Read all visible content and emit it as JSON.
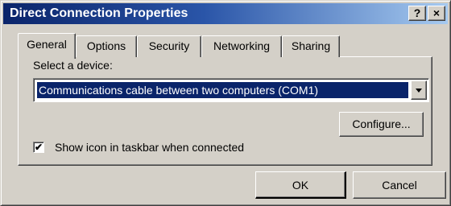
{
  "window": {
    "title": "Direct Connection Properties",
    "help_glyph": "?",
    "close_glyph": "×"
  },
  "tabs": [
    {
      "label": "General",
      "active": true
    },
    {
      "label": "Options",
      "active": false
    },
    {
      "label": "Security",
      "active": false
    },
    {
      "label": "Networking",
      "active": false
    },
    {
      "label": "Sharing",
      "active": false
    }
  ],
  "general": {
    "select_label": "Select a device:",
    "device_value": "Communications cable between two computers (COM1)",
    "configure_label": "Configure...",
    "show_icon_label": "Show icon in taskbar when connected",
    "show_icon_checked": true,
    "check_glyph": "✔"
  },
  "footer": {
    "ok_label": "OK",
    "cancel_label": "Cancel"
  },
  "colors": {
    "face": "#d4d0c8",
    "title_start": "#0a246a",
    "title_end": "#a6caf0",
    "selection": "#0a246a"
  }
}
